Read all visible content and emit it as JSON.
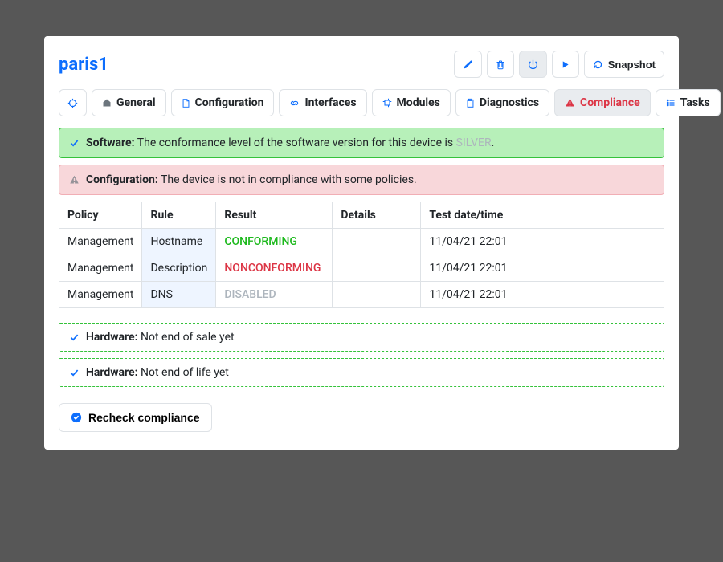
{
  "device_title": "paris1",
  "header_actions": {
    "snapshot_label": "Snapshot"
  },
  "tabs": {
    "general": "General",
    "configuration": "Configuration",
    "interfaces": "Interfaces",
    "modules": "Modules",
    "diagnostics": "Diagnostics",
    "compliance": "Compliance",
    "tasks": "Tasks"
  },
  "alerts": {
    "software_label": "Software:",
    "software_text_pre": "The conformance level of the software version for this device is ",
    "software_level": "SILVER",
    "software_text_post": ".",
    "config_label": "Configuration:",
    "config_text": "The device is not in compliance with some policies."
  },
  "table": {
    "headers": {
      "policy": "Policy",
      "rule": "Rule",
      "result": "Result",
      "details": "Details",
      "date": "Test date/time"
    },
    "rows": [
      {
        "policy": "Management",
        "rule": "Hostname",
        "result": "CONFORMING",
        "details": "",
        "date": "11/04/21 22:01"
      },
      {
        "policy": "Management",
        "rule": "Description",
        "result": "NONCONFORMING",
        "details": "",
        "date": "11/04/21 22:01"
      },
      {
        "policy": "Management",
        "rule": "DNS",
        "result": "DISABLED",
        "details": "",
        "date": "11/04/21 22:01"
      }
    ]
  },
  "hardware": {
    "label": "Hardware:",
    "eos_text": "Not end of sale yet",
    "eol_text": "Not end of life yet"
  },
  "recheck_label": "Recheck compliance",
  "colors": {
    "primary": "#0d6efd",
    "danger": "#dc3545",
    "success": "#1db91d",
    "muted": "#adb5bd"
  }
}
